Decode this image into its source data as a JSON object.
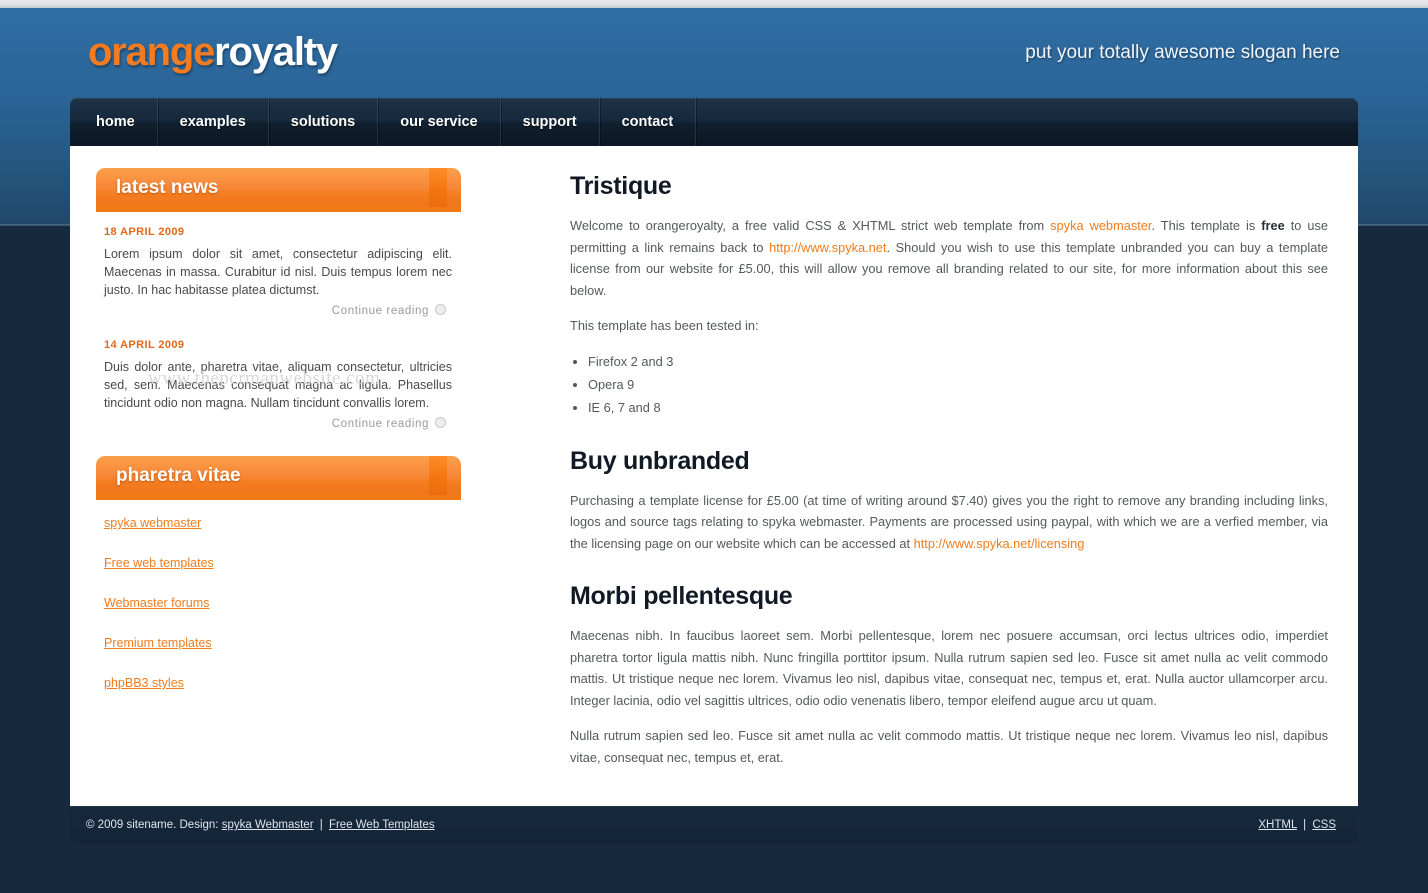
{
  "site": {
    "logo_part1": "orange",
    "logo_part2": "royalty",
    "slogan": "put your totally awesome slogan here",
    "watermark": "www.thepcrmanwebsite.com"
  },
  "colors": {
    "accent_orange": "#f47c20",
    "logo_white": "#ffffff",
    "nav_dark": "#16293c",
    "page_bg_top": "#2f6da3",
    "page_bg_bottom": "#17293c",
    "link_orange": "#ef7c1e",
    "heading_dark": "#111a24",
    "body_text": "#55585c"
  },
  "nav": {
    "items": [
      {
        "label": "home"
      },
      {
        "label": "examples"
      },
      {
        "label": "solutions"
      },
      {
        "label": "our service"
      },
      {
        "label": "support"
      },
      {
        "label": "contact"
      }
    ]
  },
  "sidebar": {
    "news_block": {
      "title": "latest news",
      "items": [
        {
          "date": "18 APRIL 2009",
          "text": "Lorem ipsum dolor sit amet, consectetur adipiscing elit. Maecenas in massa. Curabitur id nisl. Duis tempus lorem nec justo. In hac habitasse platea dictumst.",
          "more_label": "Continue reading"
        },
        {
          "date": "14 APRIL 2009",
          "text": "Duis dolor ante, pharetra vitae, aliquam consectetur, ultricies sed, sem. Maecenas consequat magna ac ligula. Phasellus tincidunt odio non magna. Nullam tincidunt convallis lorem.",
          "more_label": "Continue reading"
        }
      ]
    },
    "links_block": {
      "title": "pharetra vitae",
      "links": [
        {
          "label": "spyka webmaster"
        },
        {
          "label": "Free web templates"
        },
        {
          "label": "Webmaster forums"
        },
        {
          "label": "Premium templates"
        },
        {
          "label": "phpBB3 styles"
        }
      ]
    }
  },
  "main": {
    "section1": {
      "heading": "Tristique",
      "p1_a": "Welcome to orangeroyalty, a free valid CSS & XHTML strict web template from ",
      "p1_link1": "spyka webmaster",
      "p1_b": ". This template is ",
      "p1_bold": "free",
      "p1_c": " to use permitting a link remains back to ",
      "p1_link2": "http://www.spyka.net",
      "p1_d": ". Should you wish to use this template unbranded you can buy a template license from our website for £5.00, this will allow you remove all branding related to our site, for more information about this see below.",
      "p2": "This template has been tested in:",
      "tested_in": [
        "Firefox 2 and 3",
        "Opera 9",
        "IE 6, 7 and 8"
      ]
    },
    "section2": {
      "heading": "Buy unbranded",
      "p1_a": "Purchasing a template license for £5.00 (at time of writing around $7.40) gives you the right to remove any branding including links, logos and source tags relating to spyka webmaster. Payments are processed using paypal, with which we are a verfied member, via the licensing page on our website which can be accessed at ",
      "p1_link": "http://www.spyka.net/licensing"
    },
    "section3": {
      "heading": "Morbi pellentesque",
      "p1": "Maecenas nibh. In faucibus laoreet sem. Morbi pellentesque, lorem nec posuere accumsan, orci lectus ultrices odio, imperdiet pharetra tortor ligula mattis nibh. Nunc fringilla porttitor ipsum. Nulla rutrum sapien sed leo. Fusce sit amet nulla ac velit commodo mattis. Ut tristique neque nec lorem. Vivamus leo nisl, dapibus vitae, consequat nec, tempus et, erat. Nulla auctor ullamcorper arcu. Integer lacinia, odio vel sagittis ultrices, odio odio venenatis libero, tempor eleifend augue arcu ut quam.",
      "p2": "Nulla rutrum sapien sed leo. Fusce sit amet nulla ac velit commodo mattis. Ut tristique neque nec lorem. Vivamus leo nisl, dapibus vitae, consequat nec, tempus et, erat."
    }
  },
  "footer": {
    "copyright": "© 2009 sitename. Design:",
    "design_link": "spyka Webmaster",
    "separator": "|",
    "templates_link": "Free Web Templates",
    "xhtml_link": "XHTML",
    "css_link": "CSS"
  }
}
